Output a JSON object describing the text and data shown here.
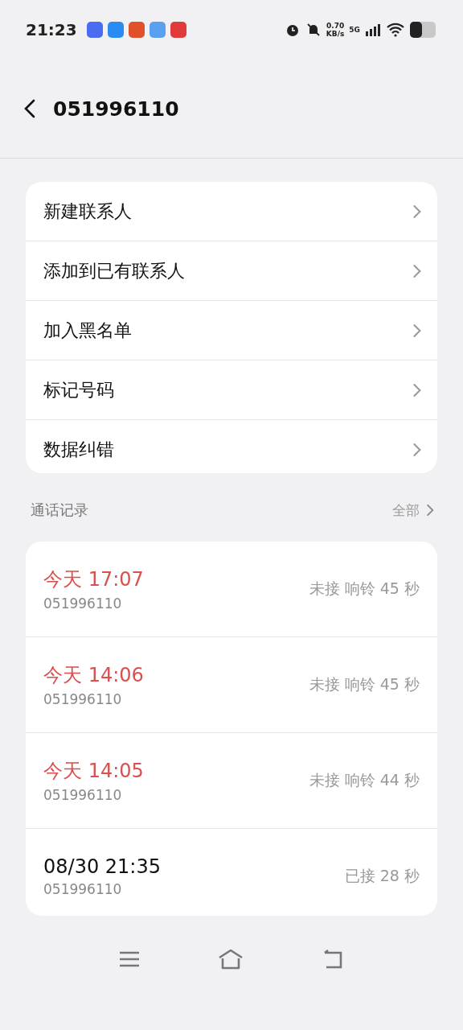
{
  "status_bar": {
    "time": "21:23",
    "app_icons": [
      {
        "color": "#4a6cf0"
      },
      {
        "color": "#2a8cf0"
      },
      {
        "color": "#e0502a"
      },
      {
        "color": "#5aa0f0"
      },
      {
        "color": "#e03a3a"
      }
    ],
    "net_speed": "0.70",
    "net_unit": "KB/s",
    "network": "5G"
  },
  "header": {
    "title": "051996110"
  },
  "actions": [
    {
      "label": "新建联系人"
    },
    {
      "label": "添加到已有联系人"
    },
    {
      "label": "加入黑名单"
    },
    {
      "label": "标记号码"
    },
    {
      "label": "数据纠错"
    }
  ],
  "call_log": {
    "title": "通话记录",
    "all_link": "全部",
    "calls": [
      {
        "time": "今天 17:07",
        "number": "051996110",
        "status": "未接 响铃 45 秒",
        "missed": true
      },
      {
        "time": "今天 14:06",
        "number": "051996110",
        "status": "未接 响铃 45 秒",
        "missed": true
      },
      {
        "time": "今天 14:05",
        "number": "051996110",
        "status": "未接 响铃 44 秒",
        "missed": true
      },
      {
        "time": "08/30 21:35",
        "number": "051996110",
        "status": "已接 28 秒",
        "missed": false
      }
    ]
  }
}
